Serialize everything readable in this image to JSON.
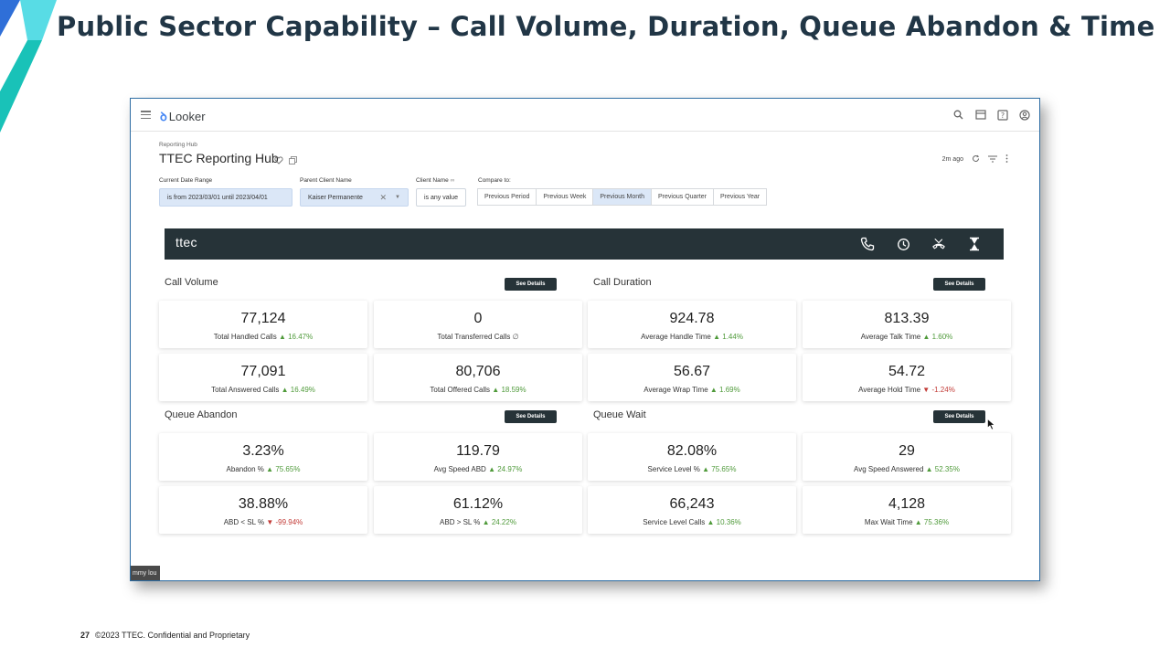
{
  "slide": {
    "title": "Public Sector Capability – Call Volume, Duration, Queue Abandon & Time",
    "page_number": "27",
    "footer_text": "©2023 TTEC. Confidential and Proprietary",
    "accent_colors": [
      "#1fc7d4",
      "#2f6fd8"
    ]
  },
  "looker": {
    "app_name": "Looker",
    "toolbar_icons": [
      "search-icon",
      "marketplace-icon",
      "help-icon",
      "account-icon"
    ]
  },
  "dashboard": {
    "breadcrumb": "Reporting Hub",
    "title": "TTEC Reporting Hub",
    "last_updated": "2m ago",
    "filters": {
      "date_range_label": "Current Date Range",
      "date_range_value": "is from 2023/03/01 until 2023/04/01",
      "parent_client_label": "Parent Client Name",
      "parent_client_value": "Kaiser Permanente",
      "client_name_label": "Client Name",
      "client_name_value": "is any value",
      "compare_label": "Compare to:",
      "compare_options": [
        "Previous Period",
        "Previous Week",
        "Previous Month",
        "Previous Quarter",
        "Previous Year"
      ],
      "compare_selected": "Previous Month"
    },
    "brand_bar": {
      "logo_text": "ttec",
      "background": "#263338",
      "icons": [
        "phone-icon",
        "clock-icon",
        "call-abandon-icon",
        "hourglass-icon"
      ]
    },
    "see_details_label": "See Details",
    "sections": {
      "call_volume": {
        "title": "Call Volume",
        "metrics": [
          {
            "value": "77,124",
            "label": "Total Handled Calls",
            "arrow": "▲",
            "change": "16.47%",
            "trend": "up"
          },
          {
            "value": "0",
            "label": "Total Transferred Calls",
            "arrow": "",
            "change": "∅",
            "trend": "na"
          },
          {
            "value": "77,091",
            "label": "Total Answered Calls",
            "arrow": "▲",
            "change": "16.49%",
            "trend": "up"
          },
          {
            "value": "80,706",
            "label": "Total Offered Calls",
            "arrow": "▲",
            "change": "18.59%",
            "trend": "up"
          }
        ]
      },
      "call_duration": {
        "title": "Call Duration",
        "metrics": [
          {
            "value": "924.78",
            "label": "Average Handle Time",
            "arrow": "▲",
            "change": "1.44%",
            "trend": "up"
          },
          {
            "value": "813.39",
            "label": "Average Talk Time",
            "arrow": "▲",
            "change": "1.60%",
            "trend": "up"
          },
          {
            "value": "56.67",
            "label": "Average Wrap Time",
            "arrow": "▲",
            "change": "1.69%",
            "trend": "up"
          },
          {
            "value": "54.72",
            "label": "Average Hold Time",
            "arrow": "▼",
            "change": "-1.24%",
            "trend": "down"
          }
        ]
      },
      "queue_abandon": {
        "title": "Queue Abandon",
        "metrics": [
          {
            "value": "3.23%",
            "label": "Abandon %",
            "arrow": "▲",
            "change": "75.65%",
            "trend": "up"
          },
          {
            "value": "119.79",
            "label": "Avg Speed ABD",
            "arrow": "▲",
            "change": "24.97%",
            "trend": "up"
          },
          {
            "value": "38.88%",
            "label": "ABD < SL %",
            "arrow": "▼",
            "change": "-99.94%",
            "trend": "down"
          },
          {
            "value": "61.12%",
            "label": "ABD > SL %",
            "arrow": "▲",
            "change": "24.22%",
            "trend": "up"
          }
        ]
      },
      "queue_wait": {
        "title": "Queue Wait",
        "metrics": [
          {
            "value": "82.08%",
            "label": "Service Level %",
            "arrow": "▲",
            "change": "75.65%",
            "trend": "up"
          },
          {
            "value": "29",
            "label": "Avg Speed Answered",
            "arrow": "▲",
            "change": "52.35%",
            "trend": "up"
          },
          {
            "value": "66,243",
            "label": "Service Level Calls",
            "arrow": "▲",
            "change": "10.36%",
            "trend": "up"
          },
          {
            "value": "4,128",
            "label": "Max Wait Time",
            "arrow": "▲",
            "change": "75.36%",
            "trend": "up"
          }
        ]
      }
    },
    "presenter_tag": "mmy lou"
  }
}
